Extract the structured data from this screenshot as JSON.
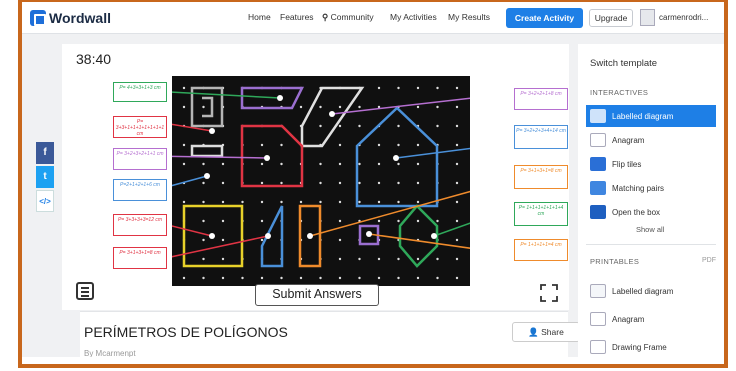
{
  "app": {
    "logo": "Wordwall"
  },
  "nav": {
    "items": [
      "Home",
      "Features",
      "Community",
      "My Activities",
      "My Results"
    ],
    "create_label": "Create Activity",
    "upgrade_label": "Upgrade",
    "username": "carmenrodri..."
  },
  "activity": {
    "timer": "38:40",
    "submit_label": "Submit Answers",
    "labels": [
      "P= 4+3+3+1+3 cm",
      "P= 3+3+1+1+1+1+1+1+1 cm",
      "P= 3+2+3+2+1+1 cm",
      "P=2+1+2+1+6 cm",
      "P= 3+3+3+3=12 cm",
      "P= 3+1+3+1=8 cm",
      "P= 3+2+2+1+8 cm",
      "P= 3+2+2+3+4+14 cm",
      "P= 3+1+3+1=8 cm",
      "P= 1+1+1+1+1+1+4 cm",
      "P= 1+1+1+1=4 cm"
    ],
    "title": "PERÍMETROS DE POLÍGONOS",
    "author": "By  Mcarmenpt",
    "share_label": "Share"
  },
  "sidebar": {
    "title": "Switch template",
    "section_interactives": "INTERACTIVES",
    "interactives": [
      "Labelled diagram",
      "Anagram",
      "Flip tiles",
      "Matching pairs",
      "Open the box"
    ],
    "show_all": "Show all",
    "section_printables": "PRINTABLES",
    "pdf": "PDF",
    "printables": [
      "Labelled diagram",
      "Anagram",
      "Drawing Frame"
    ]
  },
  "colors": {
    "accent": "#1e7fe6",
    "frame": "#c8671c",
    "board": "#101010"
  }
}
